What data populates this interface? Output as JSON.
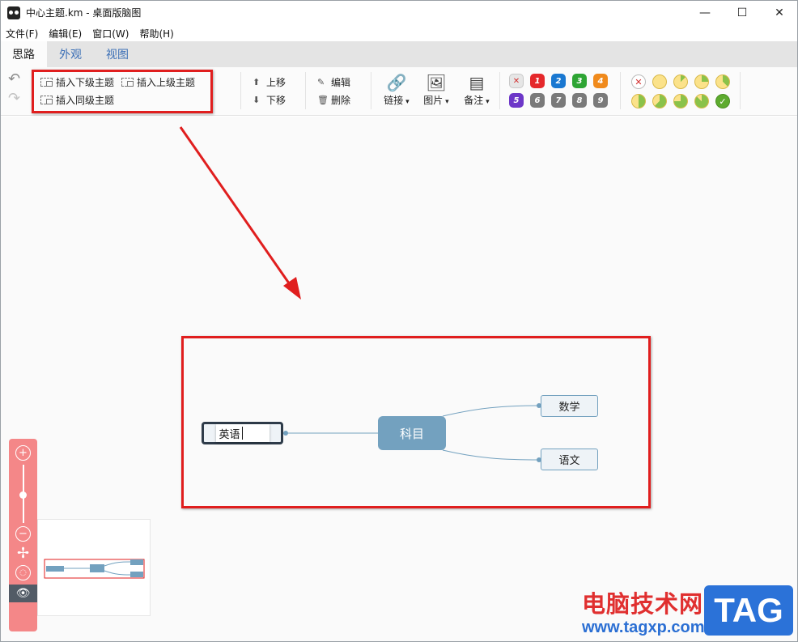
{
  "window": {
    "title": "中心主题.km - 桌面版脑图",
    "minimize": "—",
    "maximize": "☐",
    "close": "✕"
  },
  "menu": [
    "文件(F)",
    "编辑(E)",
    "窗口(W)",
    "帮助(H)"
  ],
  "tabs": [
    {
      "label": "思路",
      "active": true
    },
    {
      "label": "外观",
      "active": false
    },
    {
      "label": "视图",
      "active": false
    }
  ],
  "toolbar": {
    "insert_child": "插入下级主题",
    "insert_parent": "插入上级主题",
    "insert_sibling": "插入同级主题",
    "move_up": "上移",
    "move_down": "下移",
    "edit": "编辑",
    "delete": "删除",
    "link": "链接",
    "image": "图片",
    "note": "备注",
    "priorities": [
      "✕",
      "1",
      "2",
      "3",
      "4",
      "5",
      "6",
      "7",
      "8",
      "9"
    ],
    "priority_colors": [
      "#e6e6e6",
      "#e5282b",
      "#1a78d1",
      "#2ea534",
      "#f08a1c",
      "#6d37c8",
      "#7a7a7a",
      "#7a7a7a",
      "#7a7a7a",
      "#7a7a7a"
    ],
    "progress_levels": [
      "none",
      "0",
      "1/8",
      "2/8",
      "3/8",
      "4/8",
      "5/8",
      "6/8",
      "7/8",
      "done"
    ]
  },
  "mindmap": {
    "root": "科目",
    "children": [
      "数学",
      "语文"
    ],
    "editing_node": "英语"
  },
  "watermark": {
    "text": "电脑技术网",
    "url": "www.tagxp.com",
    "tag": "TAG"
  },
  "colors": {
    "accent": "#73a1bf",
    "highlight_red": "#e01e1e",
    "zoom_panel": "#f48788"
  }
}
